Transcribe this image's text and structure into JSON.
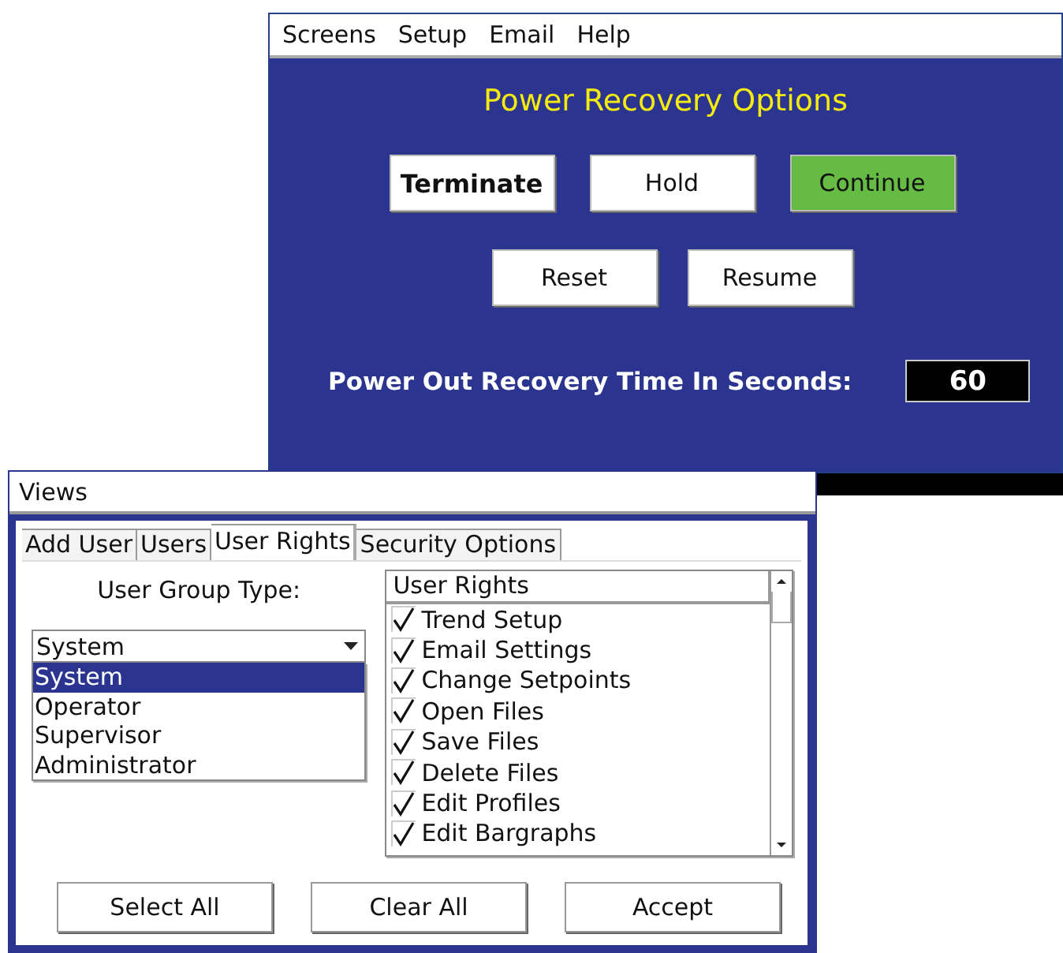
{
  "power_window": {
    "menu": [
      "Screens",
      "Setup",
      "Email",
      "Help"
    ],
    "title": "Power Recovery Options",
    "button_rows": [
      [
        {
          "label": "Terminate",
          "kind": "bold",
          "selected": false
        },
        {
          "label": "Hold",
          "kind": "plain",
          "selected": false
        },
        {
          "label": "Continue",
          "kind": "plain",
          "selected": true
        }
      ],
      [
        {
          "label": "Reset",
          "kind": "plain",
          "selected": false
        },
        {
          "label": "Resume",
          "kind": "plain",
          "selected": false
        }
      ]
    ],
    "recovery_label": "Power Out Recovery Time In Seconds:",
    "recovery_value": "60"
  },
  "views_window": {
    "title": "Views",
    "tabs": [
      {
        "label": "Add User",
        "selected": false
      },
      {
        "label": "Users",
        "selected": false
      },
      {
        "label": "User Rights",
        "selected": true
      },
      {
        "label": "Security Options",
        "selected": false
      }
    ],
    "group_label": "User Group Type:",
    "group_value": "System",
    "group_options": [
      {
        "label": "System",
        "selected": true
      },
      {
        "label": "Operator",
        "selected": false
      },
      {
        "label": "Supervisor",
        "selected": false
      },
      {
        "label": "Administrator",
        "selected": false
      }
    ],
    "rights_header": "User Rights",
    "rights": [
      {
        "label": "Trend Setup",
        "checked": true
      },
      {
        "label": "Email Settings",
        "checked": true
      },
      {
        "label": "Change Setpoints",
        "checked": true
      },
      {
        "label": "Open Files",
        "checked": true
      },
      {
        "label": "Save Files",
        "checked": true
      },
      {
        "label": "Delete Files",
        "checked": true
      },
      {
        "label": "Edit Profiles",
        "checked": true
      },
      {
        "label": "Edit Bargraphs",
        "checked": true
      }
    ],
    "buttons": [
      "Select All",
      "Clear All",
      "Accept"
    ]
  }
}
